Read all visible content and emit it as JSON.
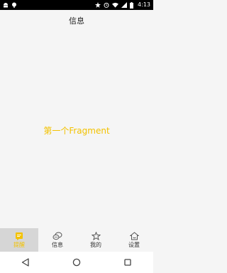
{
  "status_bar": {
    "time": "4:13",
    "icons": [
      "android-icon",
      "notification-icon",
      "star-icon",
      "alarm-icon",
      "wifi-icon",
      "signal-icon",
      "battery-icon"
    ]
  },
  "title_bar": {
    "title": "信息"
  },
  "content": {
    "text": "第一个Fragment"
  },
  "tabs": [
    {
      "label": "提醒",
      "icon": "message-square-icon",
      "active": true
    },
    {
      "label": "信息",
      "icon": "chat-bubbles-icon",
      "active": false
    },
    {
      "label": "我的",
      "icon": "star-outline-icon",
      "active": false
    },
    {
      "label": "设置",
      "icon": "home-icon",
      "active": false
    }
  ],
  "nav_bar": {
    "buttons": [
      "back-icon",
      "home-circle-icon",
      "recents-icon"
    ]
  },
  "colors": {
    "accent": "#f3c200",
    "active_tab_bg": "#d6d6d6",
    "background": "#f5f5f5"
  }
}
